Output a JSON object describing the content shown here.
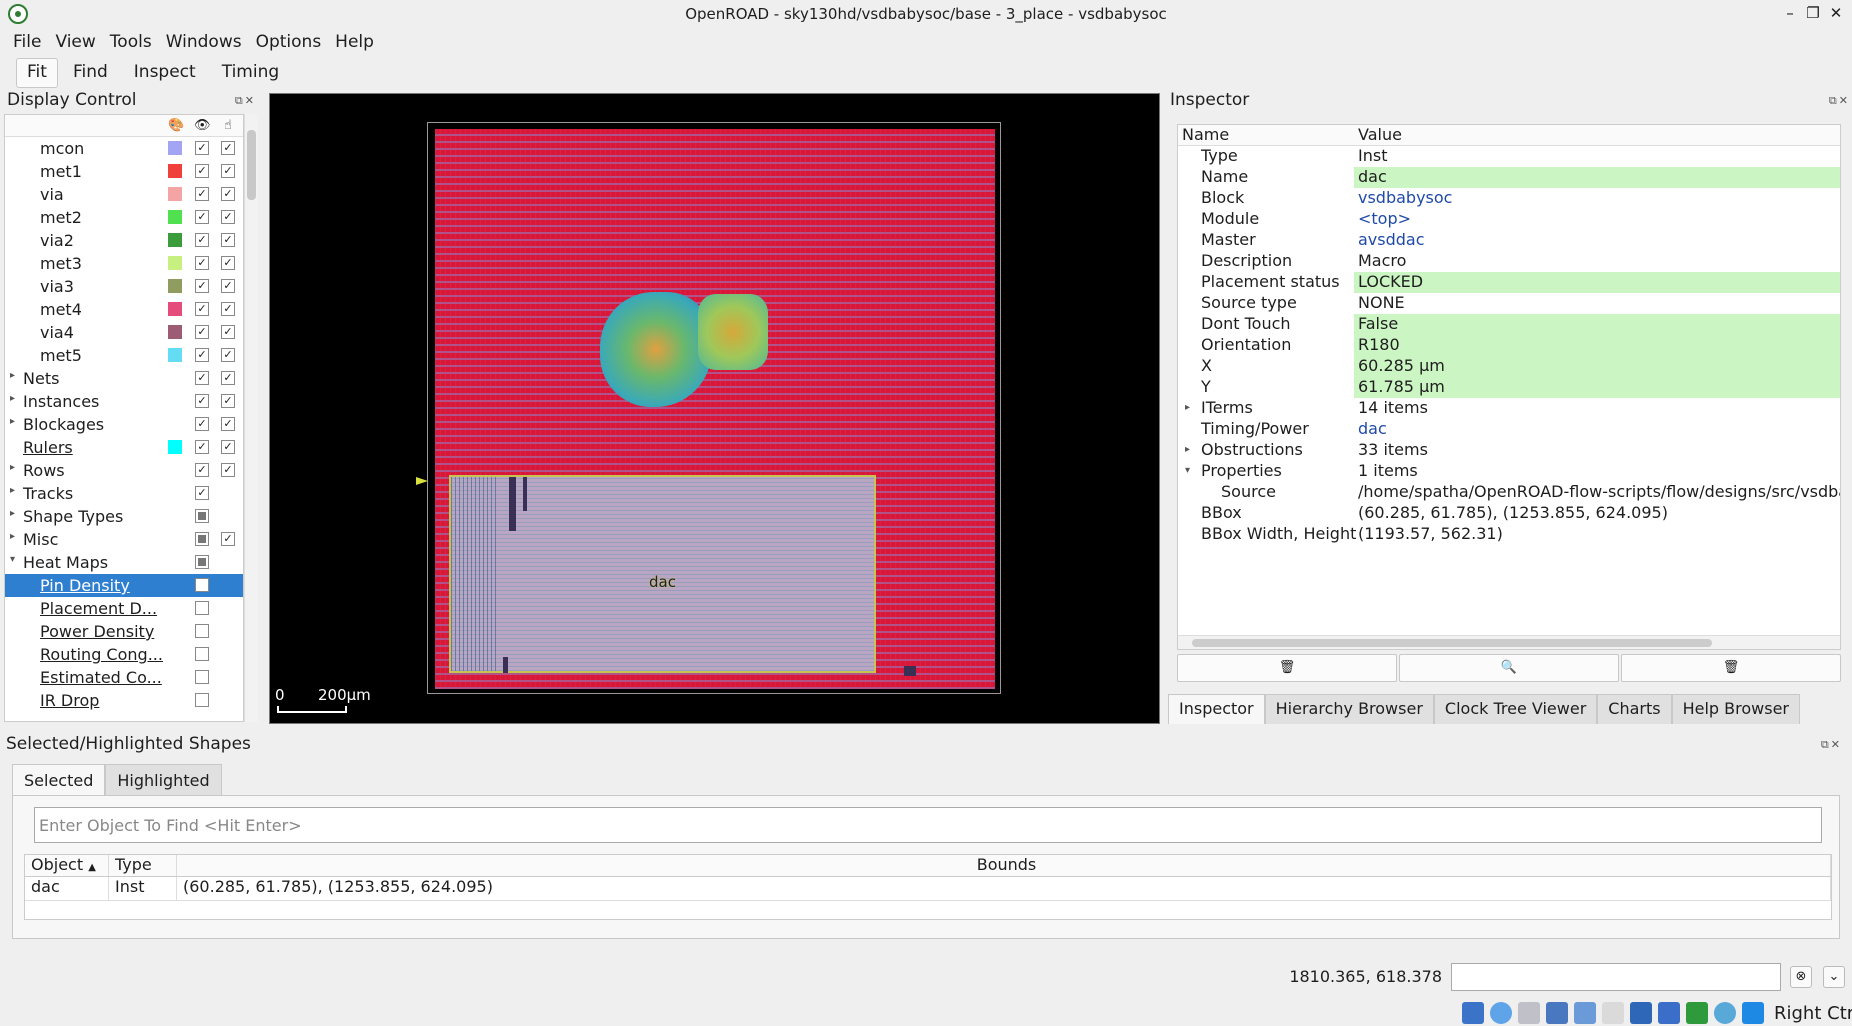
{
  "window": {
    "title": "OpenROAD - sky130hd/vsdbabysoc/base - 3_place - vsdbabysoc",
    "controls": [
      "–",
      "❐",
      "✕"
    ]
  },
  "menu": [
    {
      "label": "File"
    },
    {
      "label": "View"
    },
    {
      "label": "Tools"
    },
    {
      "label": "Windows"
    },
    {
      "label": "Options"
    },
    {
      "label": "Help"
    }
  ],
  "toolbar": {
    "fit": "Fit",
    "find": "Find",
    "inspect": "Inspect",
    "timing": "Timing"
  },
  "display_control": {
    "title": "Display Control",
    "rows": [
      {
        "label": "mcon",
        "color": "#a4a4f4",
        "visible": true,
        "selectable": true,
        "child": true
      },
      {
        "label": "met1",
        "color": "#f0403c",
        "visible": true,
        "selectable": true,
        "child": true
      },
      {
        "label": "via",
        "color": "#f4a4a4",
        "visible": true,
        "selectable": true,
        "child": true
      },
      {
        "label": "met2",
        "color": "#50e050",
        "visible": true,
        "selectable": true,
        "child": true
      },
      {
        "label": "via2",
        "color": "#3c9c3c",
        "visible": true,
        "selectable": true,
        "child": true
      },
      {
        "label": "met3",
        "color": "#c8f080",
        "visible": true,
        "selectable": true,
        "child": true
      },
      {
        "label": "via3",
        "color": "#909c60",
        "visible": true,
        "selectable": true,
        "child": true
      },
      {
        "label": "met4",
        "color": "#e44c7c",
        "visible": true,
        "selectable": true,
        "child": true
      },
      {
        "label": "via4",
        "color": "#9c5c74",
        "visible": true,
        "selectable": true,
        "child": true
      },
      {
        "label": "met5",
        "color": "#64dcf4",
        "visible": true,
        "selectable": true,
        "child": true
      },
      {
        "label": "Nets",
        "expandable": true,
        "visible": true,
        "selectable": true
      },
      {
        "label": "Instances",
        "expandable": true,
        "visible": true,
        "selectable": true
      },
      {
        "label": "Blockages",
        "expandable": true,
        "visible": true,
        "selectable": true
      },
      {
        "label": "Rulers",
        "link": true,
        "color": "#00ffff",
        "visible": true,
        "selectable": true
      },
      {
        "label": "Rows",
        "expandable": true,
        "visible": true,
        "selectable": true
      },
      {
        "label": "Tracks",
        "expandable": true,
        "visible": true
      },
      {
        "label": "Shape Types",
        "expandable": true,
        "partial": true
      },
      {
        "label": "Misc",
        "expandable": true,
        "partial": true,
        "selectable": true
      },
      {
        "label": "Heat Maps",
        "expanded": true,
        "partial": true
      },
      {
        "label": "Pin Density",
        "child": true,
        "link": true,
        "visible": true,
        "selected": true
      },
      {
        "label": "Placement D...",
        "child": true,
        "link": true,
        "visible": false
      },
      {
        "label": "Power Density",
        "child": true,
        "link": true,
        "visible": false
      },
      {
        "label": "Routing Cong...",
        "child": true,
        "link": true,
        "visible": false
      },
      {
        "label": "Estimated Co...",
        "child": true,
        "link": true,
        "visible": false
      },
      {
        "label": "IR Drop",
        "child": true,
        "link": true,
        "visible": false
      }
    ]
  },
  "viewer": {
    "instance_label": "dac",
    "scale_zero": "0",
    "scale_label": "200μm"
  },
  "inspector": {
    "title": "Inspector",
    "col_name": "Name",
    "col_value": "Value",
    "rows": [
      {
        "name": "Type",
        "value": "Inst"
      },
      {
        "name": "Name",
        "value": "dac",
        "hl": true
      },
      {
        "name": "Block",
        "value": "vsdbabysoc",
        "link": true
      },
      {
        "name": "Module",
        "value": "<top>",
        "link": true
      },
      {
        "name": "Master",
        "value": "avsddac",
        "link": true
      },
      {
        "name": "Description",
        "value": "Macro"
      },
      {
        "name": "Placement status",
        "value": "LOCKED",
        "hl": true
      },
      {
        "name": "Source type",
        "value": "NONE"
      },
      {
        "name": "Dont Touch",
        "value": "False",
        "hl": true
      },
      {
        "name": "Orientation",
        "value": "R180",
        "hl": true
      },
      {
        "name": "X",
        "value": "60.285 μm",
        "hl": true
      },
      {
        "name": "Y",
        "value": "61.785 μm",
        "hl": true
      },
      {
        "name": "ITerms",
        "value": "14 items",
        "arrow": "collapsed"
      },
      {
        "name": "Timing/Power",
        "value": "dac",
        "link": true
      },
      {
        "name": "Obstructions",
        "value": "33 items",
        "arrow": "collapsed"
      },
      {
        "name": "Properties",
        "value": "1 items",
        "arrow": "expanded"
      },
      {
        "name": "Source",
        "value": "/home/spatha/OpenROAD-flow-scripts/flow/designs/src/vsdbabysoc",
        "indent": true
      },
      {
        "name": "BBox",
        "value": "(60.285, 61.785), (1253.855, 624.095)"
      },
      {
        "name": "BBox Width, Height",
        "value": "(1193.57, 562.31)"
      }
    ],
    "tabs": [
      "Inspector",
      "Hierarchy Browser",
      "Clock Tree Viewer",
      "Charts",
      "Help Browser"
    ]
  },
  "selected": {
    "title": "Selected/Highlighted Shapes",
    "tabs": [
      "Selected",
      "Highlighted"
    ],
    "find_placeholder": "Enter Object To Find <Hit Enter>",
    "columns": {
      "object": "Object",
      "type": "Type",
      "bounds": "Bounds"
    },
    "rows": [
      {
        "object": "dac",
        "type": "Inst",
        "bounds": "(60.285, 61.785), (1253.855, 624.095)"
      }
    ]
  },
  "status": {
    "coords": "1810.365, 618.378"
  },
  "tray": {
    "label": "Right Ctrl"
  }
}
